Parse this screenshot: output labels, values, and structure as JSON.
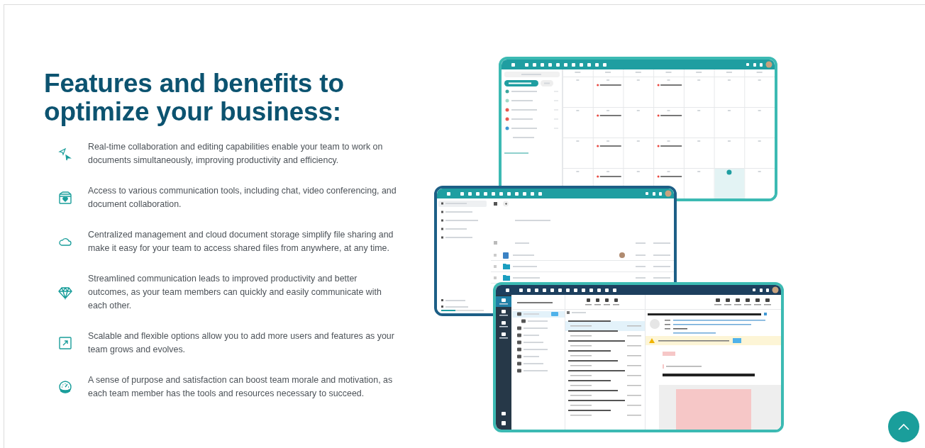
{
  "heading": "Features and benefits to optimize your business:",
  "features": [
    {
      "text": "Real-time collaboration and editing capabilities enable your team to work on documents simultaneously, improving productivity and efficiency."
    },
    {
      "text": "Access to various communication tools, including chat, video conferencing, and document collaboration."
    },
    {
      "text": "Centralized management and cloud document storage simplify file sharing and make it easy for your team to access shared files from anywhere, at any time."
    },
    {
      "text": "Streamlined communication leads to improved productivity and better outcomes, as your team members can quickly and easily communicate with each other."
    },
    {
      "text": "Scalable and flexible options allow you to add more users and features as your team grows and evolves."
    },
    {
      "text": "A sense of purpose and satisfaction can boost team morale and motivation, as each team member has the tools and resources necessary to succeed."
    }
  ]
}
